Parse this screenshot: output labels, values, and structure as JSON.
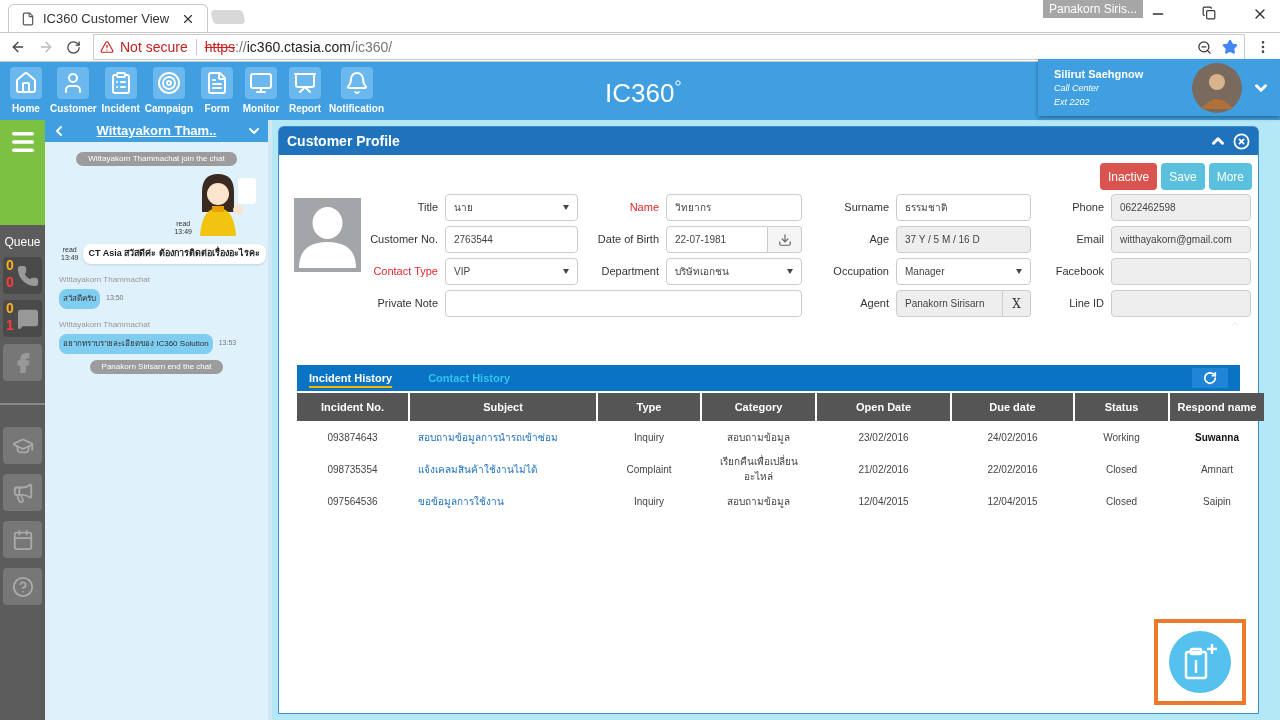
{
  "browser": {
    "tab_title": "IC360 Customer View",
    "profile_badge": "Panakorn Siris...",
    "security": "Not secure",
    "url_scheme": "https",
    "url_sep": "://",
    "url_host": "ic360.ctasia.com",
    "url_path": "/ic360/"
  },
  "nav": [
    "Home",
    "Customer",
    "Incident",
    "Campaign",
    "Form",
    "Monitor",
    "Report",
    "Notification"
  ],
  "logo": "IC360",
  "user": {
    "name": "Silirut Saehgnow",
    "role": "Call Center",
    "ext": "Ext 2202"
  },
  "queue": {
    "label": "Queue",
    "counters": [
      {
        "kind": "phone",
        "waiting": "0",
        "missed": "0"
      },
      {
        "kind": "chat",
        "waiting": "0",
        "missed": "1"
      }
    ]
  },
  "chat": {
    "title": "Wittayakorn Tham..",
    "messages": [
      {
        "kind": "system",
        "text": "Wittayakorn  Thammachat  join  the chat"
      },
      {
        "kind": "sticker",
        "read": "read",
        "time": "13:49"
      },
      {
        "kind": "agent",
        "read": "read",
        "time": "13:49",
        "text": "CT Asia สวัสดีค่ะ ต้องการติดต่อเรื่องอะไรคะ"
      },
      {
        "kind": "customer",
        "sender": "Wittayakorn  Thammachat",
        "text": "สวัสดีครับ",
        "time": "13:50"
      },
      {
        "kind": "customer",
        "sender": "Wittayakorn  Thammachat",
        "text": "อยากทราบรายละเอียดของ IC360 Solution",
        "time": "13:53"
      },
      {
        "kind": "system",
        "text": "Panakorn Sirisarn  end the chat"
      }
    ]
  },
  "profile": {
    "title": "Customer Profile",
    "buttons": [
      {
        "label": "Inactive",
        "kind": "danger"
      },
      {
        "label": "Save",
        "kind": "info"
      },
      {
        "label": "More",
        "kind": "info"
      }
    ],
    "fields": [
      {
        "label": "Title",
        "kind": "select",
        "value": "นาย",
        "required": false
      },
      {
        "label": "Name",
        "kind": "text",
        "value": "วิทยากร",
        "required": true
      },
      {
        "label": "Surname",
        "kind": "text",
        "value": "ธรรมชาติ",
        "required": false
      },
      {
        "label": "Phone",
        "kind": "readonly",
        "value": "0622462598",
        "required": false
      },
      {
        "label": "Customer No.",
        "kind": "text",
        "value": "2763544",
        "required": false
      },
      {
        "label": "Date of Birth",
        "kind": "date",
        "value": "22-07-1981",
        "required": false
      },
      {
        "label": "Age",
        "kind": "readonly",
        "value": "37 Y / 5 M / 16 D",
        "required": false
      },
      {
        "label": "Email",
        "kind": "readonly",
        "value": "witthayakorn@gmail.com",
        "required": false
      },
      {
        "label": "Contact Type",
        "kind": "select",
        "value": "VIP",
        "required": true
      },
      {
        "label": "Department",
        "kind": "select",
        "value": "บริษัทเอกชน",
        "required": false
      },
      {
        "label": "Occupation",
        "kind": "select",
        "value": "Manager",
        "required": false
      },
      {
        "label": "Facebook",
        "kind": "readonly",
        "required": false
      },
      {
        "label": "Private Note",
        "kind": "textarea",
        "required": false
      },
      {
        "label": "Agent",
        "kind": "agent",
        "value": "Panakorn Sirisarn",
        "clear": "X",
        "required": false
      },
      {
        "label": "Line ID",
        "kind": "readonly",
        "required": false
      }
    ]
  },
  "history": {
    "tabs": [
      {
        "label": "Incident History",
        "selected": true
      },
      {
        "label": "Contact History",
        "selected": false
      }
    ],
    "columns": [
      "Incident No.",
      "Subject",
      "Type",
      "Category",
      "Open Date",
      "Due date",
      "Status",
      "Respond name"
    ],
    "rows": [
      [
        "093874643",
        "สอบถามข้อมูลการนำรถเข้าซ่อม",
        "Inquiry",
        "สอบถามข้อมูล",
        "23/02/2016",
        "24/02/2016",
        "Working",
        "Suwanna"
      ],
      [
        "098735354",
        "แจ้งเคลมสินค้าใช้งานไม่ได้",
        "Complaint",
        "เรียกคืนเพื่อเปลี่ยนอะไหล่",
        "21/02/2016",
        "22/02/2016",
        "Closed",
        "Amnart"
      ],
      [
        "097564536",
        "ขอข้อมูลการใช้งาน",
        "Inquiry",
        "สอบถามข้อมูล",
        "12/04/2015",
        "12/04/2015",
        "Closed",
        "Saipin"
      ]
    ]
  }
}
